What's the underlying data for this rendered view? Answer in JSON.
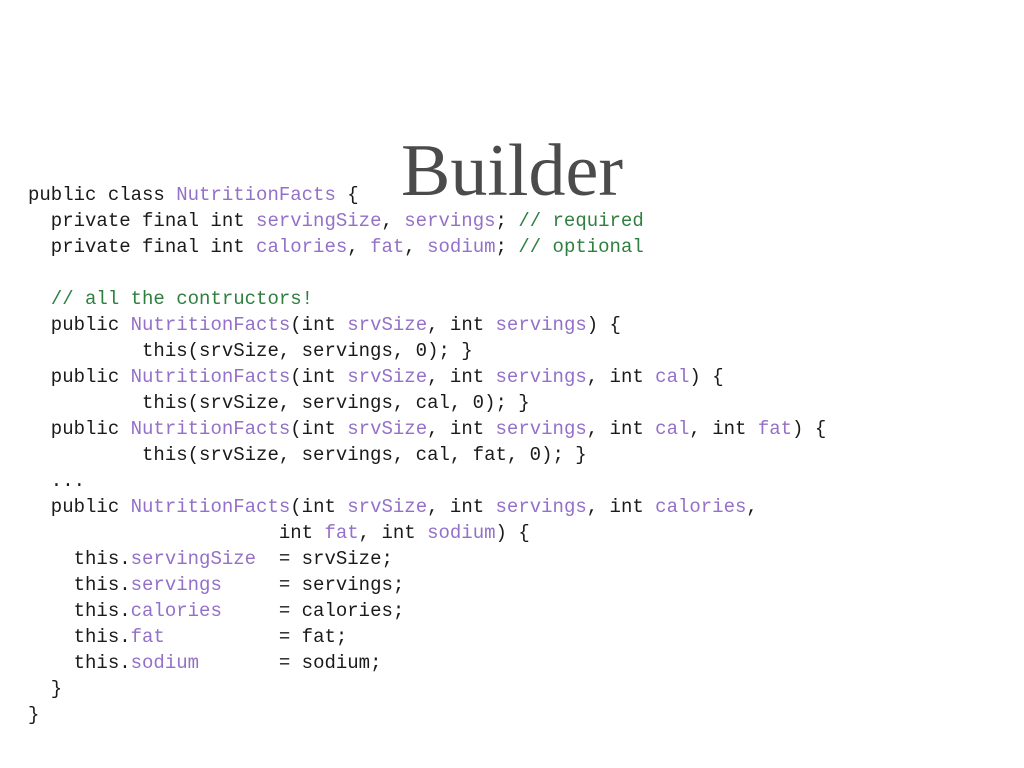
{
  "slide": {
    "title": "Builder",
    "title_color": "#4b4b4b",
    "background_color": "#ffffff"
  },
  "code": {
    "language": "java",
    "colors": {
      "plain": "#1a1a1a",
      "identifier": "#9470c8",
      "comment": "#2f7f3f"
    },
    "lines": [
      {
        "id": "line-1",
        "tokens": [
          {
            "t": "public class ",
            "c": "plain"
          },
          {
            "t": "NutritionFacts",
            "c": "ident"
          },
          {
            "t": " {",
            "c": "plain"
          }
        ]
      },
      {
        "id": "line-2",
        "tokens": [
          {
            "t": "  private final int ",
            "c": "plain"
          },
          {
            "t": "servingSize",
            "c": "ident"
          },
          {
            "t": ", ",
            "c": "plain"
          },
          {
            "t": "servings",
            "c": "ident"
          },
          {
            "t": "; ",
            "c": "plain"
          },
          {
            "t": "// required",
            "c": "comment"
          }
        ]
      },
      {
        "id": "line-3",
        "tokens": [
          {
            "t": "  private final int ",
            "c": "plain"
          },
          {
            "t": "calories",
            "c": "ident"
          },
          {
            "t": ", ",
            "c": "plain"
          },
          {
            "t": "fat",
            "c": "ident"
          },
          {
            "t": ", ",
            "c": "plain"
          },
          {
            "t": "sodium",
            "c": "ident"
          },
          {
            "t": "; ",
            "c": "plain"
          },
          {
            "t": "// optional",
            "c": "comment"
          }
        ]
      },
      {
        "id": "line-4",
        "tokens": [
          {
            "t": "",
            "c": "plain"
          }
        ]
      },
      {
        "id": "line-5",
        "tokens": [
          {
            "t": "  ",
            "c": "plain"
          },
          {
            "t": "// all the contructors!",
            "c": "comment"
          }
        ]
      },
      {
        "id": "line-6",
        "tokens": [
          {
            "t": "  public ",
            "c": "plain"
          },
          {
            "t": "NutritionFacts",
            "c": "ident"
          },
          {
            "t": "(int ",
            "c": "plain"
          },
          {
            "t": "srvSize",
            "c": "ident"
          },
          {
            "t": ", int ",
            "c": "plain"
          },
          {
            "t": "servings",
            "c": "ident"
          },
          {
            "t": ") {",
            "c": "plain"
          }
        ]
      },
      {
        "id": "line-7",
        "tokens": [
          {
            "t": "          this(srvSize, servings, 0); }",
            "c": "plain"
          }
        ]
      },
      {
        "id": "line-8",
        "tokens": [
          {
            "t": "  public ",
            "c": "plain"
          },
          {
            "t": "NutritionFacts",
            "c": "ident"
          },
          {
            "t": "(int ",
            "c": "plain"
          },
          {
            "t": "srvSize",
            "c": "ident"
          },
          {
            "t": ", int ",
            "c": "plain"
          },
          {
            "t": "servings",
            "c": "ident"
          },
          {
            "t": ", int ",
            "c": "plain"
          },
          {
            "t": "cal",
            "c": "ident"
          },
          {
            "t": ") {",
            "c": "plain"
          }
        ]
      },
      {
        "id": "line-9",
        "tokens": [
          {
            "t": "          this(srvSize, servings, cal, 0); }",
            "c": "plain"
          }
        ]
      },
      {
        "id": "line-10",
        "tokens": [
          {
            "t": "  public ",
            "c": "plain"
          },
          {
            "t": "NutritionFacts",
            "c": "ident"
          },
          {
            "t": "(int ",
            "c": "plain"
          },
          {
            "t": "srvSize",
            "c": "ident"
          },
          {
            "t": ", int ",
            "c": "plain"
          },
          {
            "t": "servings",
            "c": "ident"
          },
          {
            "t": ", int ",
            "c": "plain"
          },
          {
            "t": "cal",
            "c": "ident"
          },
          {
            "t": ", int ",
            "c": "plain"
          },
          {
            "t": "fat",
            "c": "ident"
          },
          {
            "t": ") {",
            "c": "plain"
          }
        ]
      },
      {
        "id": "line-11",
        "tokens": [
          {
            "t": "          this(srvSize, servings, cal, fat, 0); }",
            "c": "plain"
          }
        ]
      },
      {
        "id": "line-12",
        "tokens": [
          {
            "t": "  ...",
            "c": "plain"
          }
        ]
      },
      {
        "id": "line-13",
        "tokens": [
          {
            "t": "  public ",
            "c": "plain"
          },
          {
            "t": "NutritionFacts",
            "c": "ident"
          },
          {
            "t": "(int ",
            "c": "plain"
          },
          {
            "t": "srvSize",
            "c": "ident"
          },
          {
            "t": ", int ",
            "c": "plain"
          },
          {
            "t": "servings",
            "c": "ident"
          },
          {
            "t": ", int ",
            "c": "plain"
          },
          {
            "t": "calories",
            "c": "ident"
          },
          {
            "t": ",",
            "c": "plain"
          }
        ]
      },
      {
        "id": "line-14",
        "tokens": [
          {
            "t": "                      int ",
            "c": "plain"
          },
          {
            "t": "fat",
            "c": "ident"
          },
          {
            "t": ", int ",
            "c": "plain"
          },
          {
            "t": "sodium",
            "c": "ident"
          },
          {
            "t": ") {",
            "c": "plain"
          }
        ]
      },
      {
        "id": "line-15",
        "tokens": [
          {
            "t": "    this.",
            "c": "plain"
          },
          {
            "t": "servingSize",
            "c": "ident"
          },
          {
            "t": "  = srvSize;",
            "c": "plain"
          }
        ]
      },
      {
        "id": "line-16",
        "tokens": [
          {
            "t": "    this.",
            "c": "plain"
          },
          {
            "t": "servings",
            "c": "ident"
          },
          {
            "t": "     = servings;",
            "c": "plain"
          }
        ]
      },
      {
        "id": "line-17",
        "tokens": [
          {
            "t": "    this.",
            "c": "plain"
          },
          {
            "t": "calories",
            "c": "ident"
          },
          {
            "t": "     = calories;",
            "c": "plain"
          }
        ]
      },
      {
        "id": "line-18",
        "tokens": [
          {
            "t": "    this.",
            "c": "plain"
          },
          {
            "t": "fat",
            "c": "ident"
          },
          {
            "t": "          = fat;",
            "c": "plain"
          }
        ]
      },
      {
        "id": "line-19",
        "tokens": [
          {
            "t": "    this.",
            "c": "plain"
          },
          {
            "t": "sodium",
            "c": "ident"
          },
          {
            "t": "       = sodium;",
            "c": "plain"
          }
        ]
      },
      {
        "id": "line-20",
        "tokens": [
          {
            "t": "  }",
            "c": "plain"
          }
        ]
      },
      {
        "id": "line-21",
        "tokens": [
          {
            "t": "}",
            "c": "plain"
          }
        ]
      }
    ]
  }
}
